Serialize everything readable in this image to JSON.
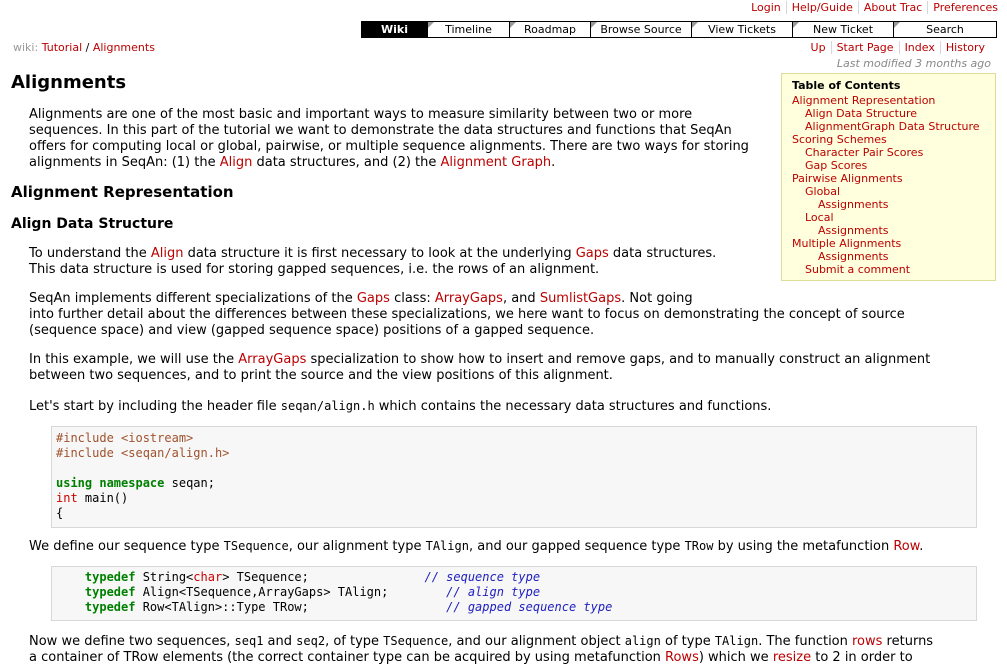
{
  "header": {
    "meta_links": [
      "Login",
      "Help/Guide",
      "About Trac",
      "Preferences"
    ]
  },
  "mainnav": [
    "Wiki",
    "Timeline",
    "Roadmap",
    "Browse Source",
    "View Tickets",
    "New Ticket",
    "Search"
  ],
  "breadcrumb": {
    "prefix": "wiki:",
    "part1": "Tutorial",
    "sep": " / ",
    "part2": "Alignments"
  },
  "ctxnav": [
    "Up",
    "Start Page",
    "Index",
    "History"
  ],
  "last_modified": "Last modified 3 months ago",
  "toc": {
    "title": "Table of Contents",
    "items": [
      {
        "label": "Alignment Representation",
        "level": 1
      },
      {
        "label": "Align Data Structure",
        "level": 2
      },
      {
        "label": "AlignmentGraph Data Structure",
        "level": 2
      },
      {
        "label": "Scoring Schemes",
        "level": 1
      },
      {
        "label": "Character Pair Scores",
        "level": 2
      },
      {
        "label": "Gap Scores",
        "level": 2
      },
      {
        "label": "Pairwise Alignments",
        "level": 1
      },
      {
        "label": "Global",
        "level": 2
      },
      {
        "label": "Assignments",
        "level": 3
      },
      {
        "label": "Local",
        "level": 2
      },
      {
        "label": "Assignments",
        "level": 3
      },
      {
        "label": "Multiple Alignments",
        "level": 1
      },
      {
        "label": "Assignments",
        "level": 3
      },
      {
        "label": "Submit a comment",
        "level": 2
      }
    ]
  },
  "content": {
    "title": "Alignments",
    "intro": {
      "t1": "Alignments are one of the most basic and important ways to measure similarity between two or more sequences. In this part of the tutorial we want to demonstrate the data structures and functions that SeqAn offers for computing local or global, pairwise, or multiple sequence alignments. There are two ways for storing alignments in SeqAn: (1) the ",
      "l1": "Align",
      "t2": " data structures, and (2) the ",
      "l2": "Alignment Graph",
      "t3": "."
    },
    "h2": "Alignment Representation",
    "h3": "Align Data Structure",
    "p1": {
      "t1": "To understand the ",
      "l1": "Align",
      "t2": " data structure it is first necessary to look at the underlying ",
      "l2": "Gaps",
      "t3": " data structures.",
      "t4": "This data structure is used for storing gapped sequences, i.e. the rows of an alignment."
    },
    "p2": {
      "t1": "SeqAn implements different specializations of the ",
      "l1": "Gaps",
      "t2": " class: ",
      "l2": "ArrayGaps",
      "t3": ", and ",
      "l3": "SumlistGaps",
      "t4": ". Not going",
      "t5": "into further detail about the differences between these specializations, we here want to focus on demonstrating the concept of source (sequence space) and view (gapped sequence space) positions of a gapped sequence."
    },
    "p3": {
      "t1": "In this example, we will use the ",
      "l1": "ArrayGaps",
      "t2": " specialization to show how to insert and remove gaps, and to manually construct an alignment between two sequences, and to print the source and the view positions of this alignment."
    },
    "p4": {
      "t1": "Let's start by including the header file ",
      "c1": "seqan/align.h",
      "t2": " which contains the necessary data structures and functions."
    },
    "code1": {
      "inc1": "#include <iostream>",
      "inc2": "#include <seqan/align.h>",
      "using": "using",
      "ns": "namespace",
      "ns_rest": " seqan;",
      "int": "int",
      "main": " main()",
      "brace": "{"
    },
    "p5": {
      "t1": "We define our sequence type ",
      "c1": "TSequence",
      "t2": ", our alignment type ",
      "c2": "TAlign",
      "t3": ", and our gapped sequence type ",
      "c3": "TRow",
      "t4": " by using the metafunction ",
      "l1": "Row",
      "t5": "."
    },
    "code2": {
      "lines": [
        {
          "kw": "typedef",
          "a": " String<",
          "b": "char",
          "c": "> TSequence;",
          "comment": "// sequence type"
        },
        {
          "kw": "typedef",
          "a": " Align<TSequence,ArrayGaps> TAlign;",
          "b": "",
          "c": "",
          "comment": "// align type"
        },
        {
          "kw": "typedef",
          "a": " Row<TAlign>::Type TRow;",
          "b": "",
          "c": "",
          "comment": "// gapped sequence type"
        }
      ]
    },
    "p6": {
      "t1": "Now we define two sequences, ",
      "c1": "seq1",
      "t2": " and ",
      "c2": "seq2",
      "t3": ", of type ",
      "c3": "TSequence",
      "t4": ", and our alignment object ",
      "c4": "align",
      "t5": " of type ",
      "c5": "TAlign",
      "t6": ". The function ",
      "l1": "rows",
      "t7": " returns",
      "t8": "a container of TRow elements (the correct container type can be acquired by using metafunction ",
      "l2": "Rows",
      "t9": ") which we ",
      "l3": "resize",
      "t10": " to 2 in order to"
    }
  }
}
